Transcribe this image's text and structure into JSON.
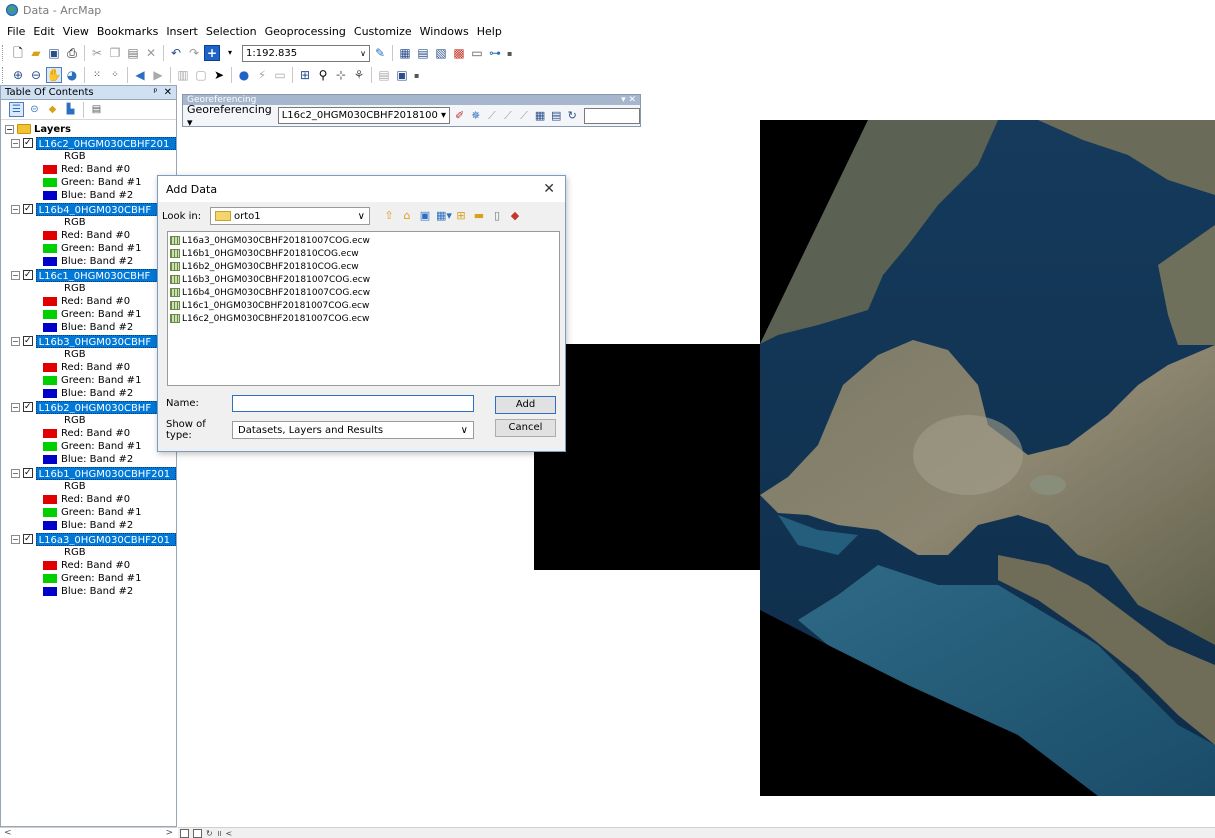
{
  "window": {
    "title": "Data - ArcMap"
  },
  "menu": [
    "File",
    "Edit",
    "View",
    "Bookmarks",
    "Insert",
    "Selection",
    "Geoprocessing",
    "Customize",
    "Windows",
    "Help"
  ],
  "toolbar": {
    "scale": "1:192.835"
  },
  "toc": {
    "title": "Table Of Contents",
    "pin_glyph": "ᵖ",
    "close_glyph": "✕",
    "root": "Layers",
    "rgb_label": "RGB",
    "bands": [
      {
        "label": "Red:  Band #0",
        "color": "#e00000"
      },
      {
        "label": "Green: Band #1",
        "color": "#00d000"
      },
      {
        "label": "Blue:  Band #2",
        "color": "#0000c8"
      }
    ],
    "layers": [
      "L16c2_0HGM030CBHF201",
      "L16b4_0HGM030CBHF",
      "L16c1_0HGM030CBHF",
      "L16b3_0HGM030CBHF",
      "L16b2_0HGM030CBHF",
      "L16b1_0HGM030CBHF201",
      "L16a3_0HGM030CBHF201"
    ]
  },
  "georeferencing": {
    "title": "Georeferencing",
    "menu_label": "Georeferencing ▾",
    "layer": "L16c2_0HGM030CBHF2018100 ▾"
  },
  "dialog": {
    "title": "Add Data",
    "look_in_label": "Look in:",
    "look_in_value": "orto1",
    "files": [
      "L16a3_0HGM030CBHF20181007COG.ecw",
      "L16b1_0HGM030CBHF201810COG.ecw",
      "L16b2_0HGM030CBHF201810COG.ecw",
      "L16b3_0HGM030CBHF20181007COG.ecw",
      "L16b4_0HGM030CBHF20181007COG.ecw",
      "L16c1_0HGM030CBHF20181007COG.ecw",
      "L16c2_0HGM030CBHF20181007COG.ecw"
    ],
    "name_label": "Name:",
    "name_value": "",
    "type_label": "Show of type:",
    "type_value": "Datasets, Layers and Results",
    "add_button": "Add",
    "cancel_button": "Cancel"
  },
  "colors": {
    "selection": "#0078d7",
    "map_black": "#000000"
  }
}
